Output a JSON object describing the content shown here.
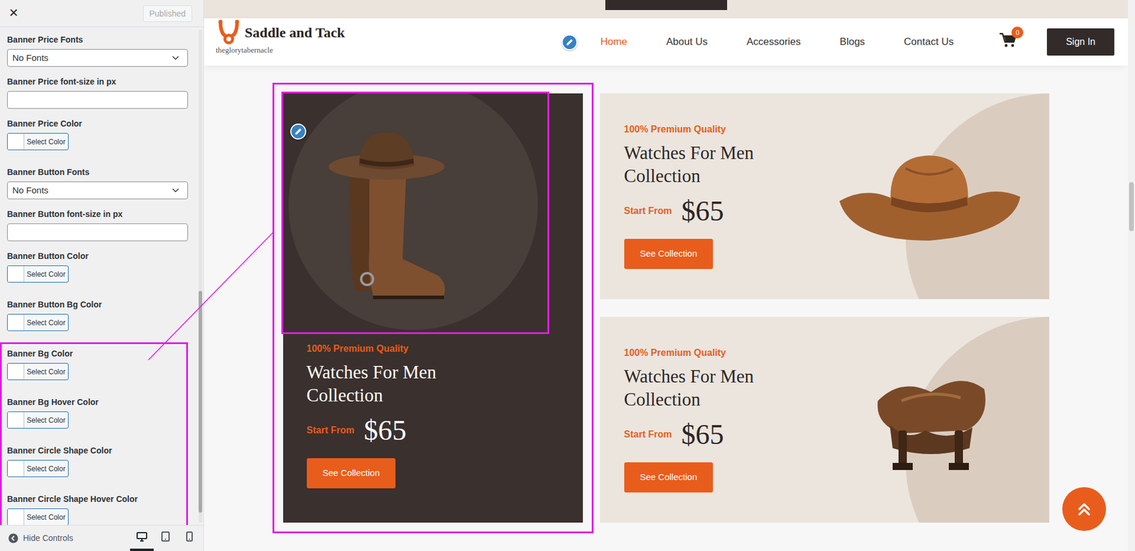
{
  "customizer": {
    "close": "×",
    "publish_button": {
      "label": "Published",
      "disabled": true
    },
    "fields": [
      {
        "label": "Banner Price Fonts",
        "kind": "select",
        "value": "No Fonts",
        "highlighted": false
      },
      {
        "label": "Banner Price font-size in px",
        "kind": "text",
        "value": "",
        "highlighted": false
      },
      {
        "label": "Banner Price Color",
        "kind": "color",
        "button": "Select Color",
        "highlighted": false
      },
      {
        "label": "Banner Button Fonts",
        "kind": "select",
        "value": "No Fonts",
        "highlighted": false
      },
      {
        "label": "Banner Button font-size in px",
        "kind": "text",
        "value": "",
        "highlighted": false
      },
      {
        "label": "Banner Button Color",
        "kind": "color",
        "button": "Select Color",
        "highlighted": false
      },
      {
        "label": "Banner Button Bg Color",
        "kind": "color",
        "button": "Select Color",
        "highlighted": false
      },
      {
        "label": "Banner Bg Color",
        "kind": "color",
        "button": "Select Color",
        "highlighted": true
      },
      {
        "label": "Banner Bg Hover Color",
        "kind": "color",
        "button": "Select Color",
        "highlighted": true
      },
      {
        "label": "Banner Circle Shape Color",
        "kind": "color",
        "button": "Select Color",
        "highlighted": true
      },
      {
        "label": "Banner Circle Shape Hover Color",
        "kind": "color",
        "button": "Select Color",
        "highlighted": true
      }
    ],
    "scrollbar": {
      "offset": 0.53,
      "level": 0.45
    },
    "footer": {
      "hide_controls": "Hide Controls",
      "devices": [
        {
          "kind": "desktop",
          "selected": true
        },
        {
          "kind": "tablet",
          "selected": false
        },
        {
          "kind": "mobile",
          "selected": false
        }
      ]
    }
  },
  "site": {
    "brand": "Saddle and Tack",
    "tagline": "theglorytabernacle",
    "edit_shortcut": true,
    "nav": [
      {
        "label": "Home",
        "selected": true
      },
      {
        "label": "About Us",
        "selected": false
      },
      {
        "label": "Accessories",
        "selected": false
      },
      {
        "label": "Blogs",
        "selected": false
      },
      {
        "label": "Contact Us",
        "selected": false
      }
    ],
    "cart_count": "0",
    "sign_in": "Sign In"
  },
  "banners": [
    {
      "kind": "featured",
      "highlighted": true,
      "image_highlighted": true,
      "edit_shortcut": true,
      "eyebrow": "100% Premium Quality",
      "title": "Watches For Men Collection",
      "price_label": "Start From",
      "price": "$65",
      "button": "See Collection"
    },
    {
      "kind": "side",
      "highlighted": false,
      "image_highlighted": false,
      "edit_shortcut": false,
      "eyebrow": "100% Premium Quality",
      "title": "Watches For Men Collection",
      "price_label": "Start From",
      "price": "$65",
      "button": "See Collection"
    },
    {
      "kind": "side",
      "highlighted": false,
      "image_highlighted": false,
      "edit_shortcut": false,
      "eyebrow": "100% Premium Quality",
      "title": "Watches For Men Collection",
      "price_label": "Start From",
      "price": "$65",
      "button": "See Collection"
    }
  ],
  "preview_scrollbar": {
    "offset": 0.33,
    "level": 0.09
  }
}
